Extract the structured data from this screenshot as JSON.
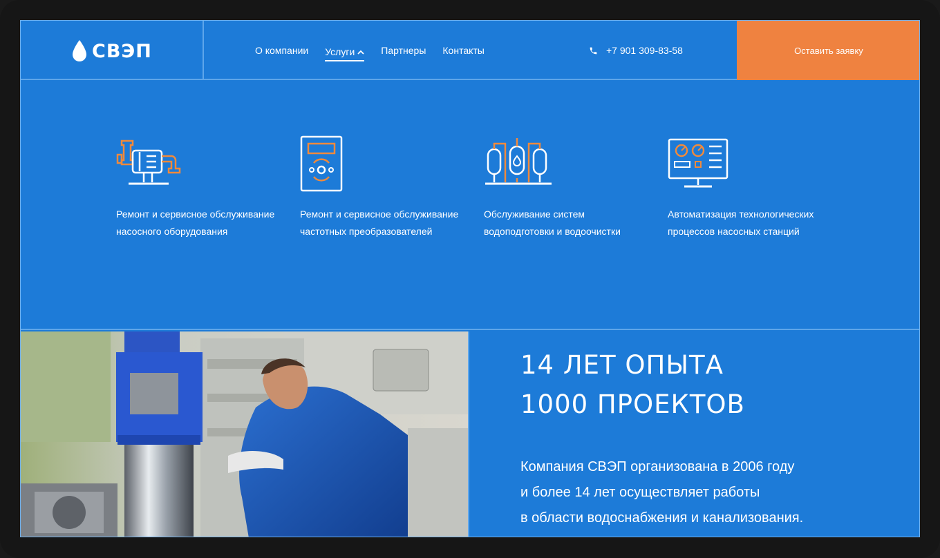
{
  "header": {
    "logo_text": "СВЭП",
    "nav": [
      {
        "label": "О компании"
      },
      {
        "label": "Услуги"
      },
      {
        "label": "Партнеры"
      },
      {
        "label": "Контакты"
      }
    ],
    "phone": "+7 901 309-83-58",
    "cta_label": "Оставить заявку"
  },
  "services": [
    {
      "label": "Ремонт и сервисное обслуживание насосного оборудования",
      "icon": "pump-icon"
    },
    {
      "label": "Ремонт и сервисное обслуживание частотных преобразователей",
      "icon": "frequency-converter-icon"
    },
    {
      "label": "Обслуживание систем водоподготовки и водоочистки",
      "icon": "water-treatment-icon"
    },
    {
      "label": "Автоматизация технологических процессов насосных станций",
      "icon": "monitor-dashboard-icon"
    }
  ],
  "stats": {
    "line1": "14 ЛЕТ ОПЫТА",
    "line2": "1000 ПРОЕКТОВ"
  },
  "about": {
    "line1": "Компания СВЭП организована в 2006 году",
    "line2": "и более 14 лет осуществляет работы",
    "line3": "в области водоснабжения и канализования."
  },
  "colors": {
    "brand_blue": "#1d7bd8",
    "accent_orange": "#ef8240",
    "divider": "#5ea6ea"
  }
}
